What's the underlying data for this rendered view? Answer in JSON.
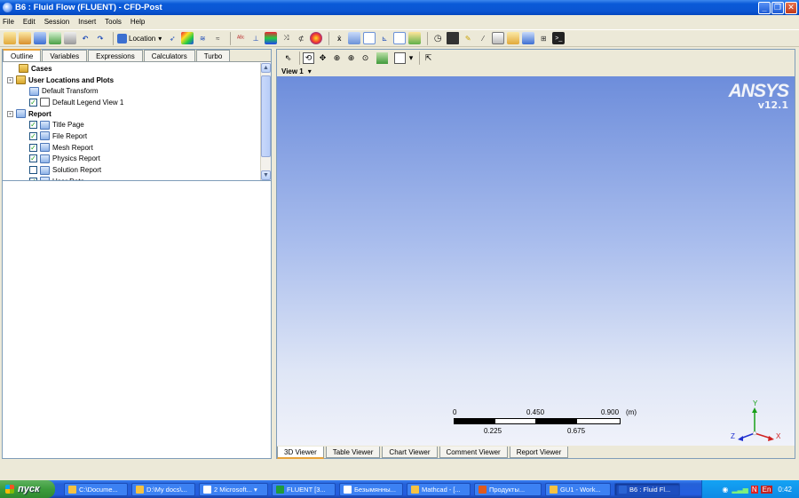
{
  "window": {
    "title": "B6 : Fluid Flow (FLUENT) - CFD-Post",
    "controls": [
      "minimize",
      "maximize",
      "close"
    ]
  },
  "menu": [
    "File",
    "Edit",
    "Session",
    "Insert",
    "Tools",
    "Help"
  ],
  "toolbar": {
    "location_label": "Location"
  },
  "left_panel": {
    "tabs": [
      "Outline",
      "Variables",
      "Expressions",
      "Calculators",
      "Turbo"
    ],
    "active_tab": "Outline",
    "tree": [
      {
        "label": "Cases",
        "bold": true,
        "icon": "folder",
        "level": 1,
        "expander": "",
        "check": null
      },
      {
        "label": "User Locations and Plots",
        "bold": true,
        "icon": "folder",
        "level": 0,
        "expander": "-",
        "check": null
      },
      {
        "label": "Default Transform",
        "bold": false,
        "icon": "transform",
        "level": 2,
        "expander": "",
        "check": null
      },
      {
        "label": "Default Legend View 1",
        "bold": false,
        "icon": "legend",
        "level": 2,
        "expander": "",
        "check": true
      },
      {
        "label": "Report",
        "bold": true,
        "icon": "doc",
        "level": 0,
        "expander": "-",
        "check": null
      },
      {
        "label": "Title Page",
        "bold": false,
        "icon": "page",
        "level": 2,
        "expander": "",
        "check": true
      },
      {
        "label": "File Report",
        "bold": false,
        "icon": "page",
        "level": 2,
        "expander": "",
        "check": true
      },
      {
        "label": "Mesh Report",
        "bold": false,
        "icon": "page",
        "level": 2,
        "expander": "",
        "check": true
      },
      {
        "label": "Physics Report",
        "bold": false,
        "icon": "page",
        "level": 2,
        "expander": "",
        "check": true
      },
      {
        "label": "Solution Report",
        "bold": false,
        "icon": "page",
        "level": 2,
        "expander": "",
        "check": false
      },
      {
        "label": "User Data",
        "bold": false,
        "icon": "page",
        "level": 2,
        "expander": "",
        "check": true
      }
    ]
  },
  "viewer": {
    "view_label": "View 1",
    "logo_text": "ANSYS",
    "logo_version": "v12.1",
    "scale": {
      "top_labels": [
        "0",
        "0.450",
        "0.900",
        "(m)"
      ],
      "bottom_labels": [
        "0.225",
        "0.675"
      ]
    },
    "axes": {
      "y": "Y",
      "x": "X",
      "z": "Z"
    },
    "tabs": [
      "3D Viewer",
      "Table Viewer",
      "Chart Viewer",
      "Comment Viewer",
      "Report Viewer"
    ],
    "active_tab": "3D Viewer"
  },
  "taskbar": {
    "start_label": "пуск",
    "tasks": [
      {
        "label": "C:\\Docume...",
        "color": "#f5c242"
      },
      {
        "label": "D:\\My docs\\...",
        "color": "#f5c242"
      },
      {
        "label": "2 Microsoft... ▾",
        "color": "#ffffff"
      },
      {
        "label": "FLUENT [3...",
        "color": "#1f9b3a"
      },
      {
        "label": "Безымянны...",
        "color": "#ffffff"
      },
      {
        "label": "Mathcad - [...",
        "color": "#f5c242"
      },
      {
        "label": "Продукты...",
        "color": "#e05a1c"
      },
      {
        "label": "GU1 - Work...",
        "color": "#f5c242"
      },
      {
        "label": "B6 : Fluid Fl...",
        "color": "#2a64d4"
      }
    ],
    "active_task": 8,
    "lang": "EN",
    "tray_lang": "En",
    "clock": "0:42"
  }
}
